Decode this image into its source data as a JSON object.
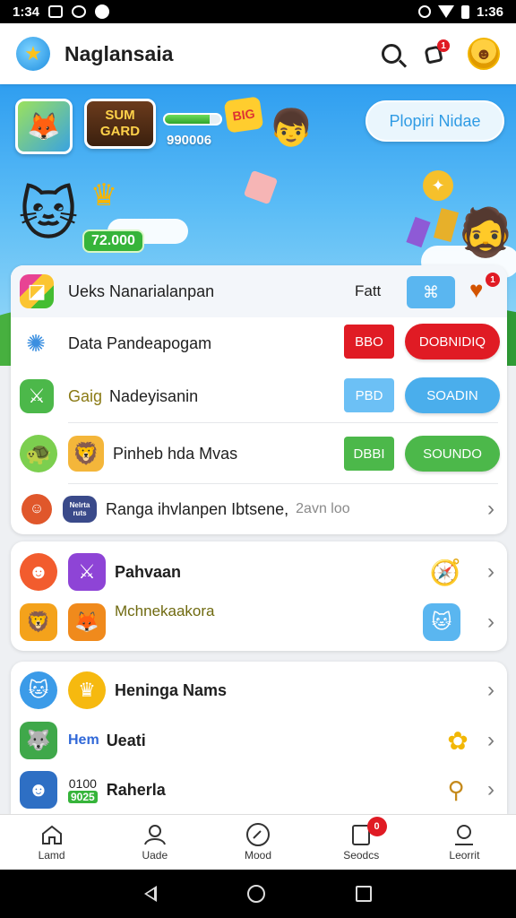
{
  "status_bar": {
    "time_left": "1:34",
    "time_right": "1:36"
  },
  "app": {
    "title": "Naglansaia"
  },
  "header": {
    "notification_count": "1"
  },
  "hero": {
    "banner_title": "SUM GARD",
    "corner_badge": "BIG",
    "progress": 0.8,
    "score": "990006",
    "coins": "72.000",
    "action_label": "Plopiri Nidae"
  },
  "main_list": {
    "rows": [
      {
        "label": "Ueks Nanarialanpan",
        "extra": "Fatt",
        "badge": "1"
      },
      {
        "label": "Data Pandeapogam",
        "btn_small": "BBO",
        "btn_large": "DOBNIDIQ"
      },
      {
        "label_prefix": "Gaig",
        "label": "Nadeyisanin",
        "btn_small": "PBD",
        "btn_large": "SOADIN"
      },
      {
        "label": "Pinheb hda Mvas",
        "btn_small": "DBBI",
        "btn_large": "SOUNDO"
      },
      {
        "icon_text": "Nelrta ruts",
        "label": "Ranga ihvlanpen Ibtsene,",
        "muted": "2avn loo"
      }
    ]
  },
  "games_card": {
    "rows": [
      {
        "label": "Pahvaan"
      },
      {
        "label": "Mchnekaakora"
      }
    ]
  },
  "friends_card": {
    "rows": [
      {
        "label": "Heninga Nams"
      },
      {
        "prefix": "Hem",
        "label": "Ueati"
      },
      {
        "prefix_top": "0100",
        "prefix_bottom": "9025",
        "label": "Raherla"
      }
    ]
  },
  "bottom_nav": {
    "items": [
      {
        "label": "Lamd"
      },
      {
        "label": "Uade"
      },
      {
        "label": "Mood"
      },
      {
        "label": "Seodcs",
        "badge": "0"
      },
      {
        "label": "Leorrit"
      }
    ]
  },
  "colors": {
    "red": "#e01b24",
    "blue": "#5ab6f0",
    "green": "#4cb84a",
    "hero_blue": "#2f9ef0"
  }
}
